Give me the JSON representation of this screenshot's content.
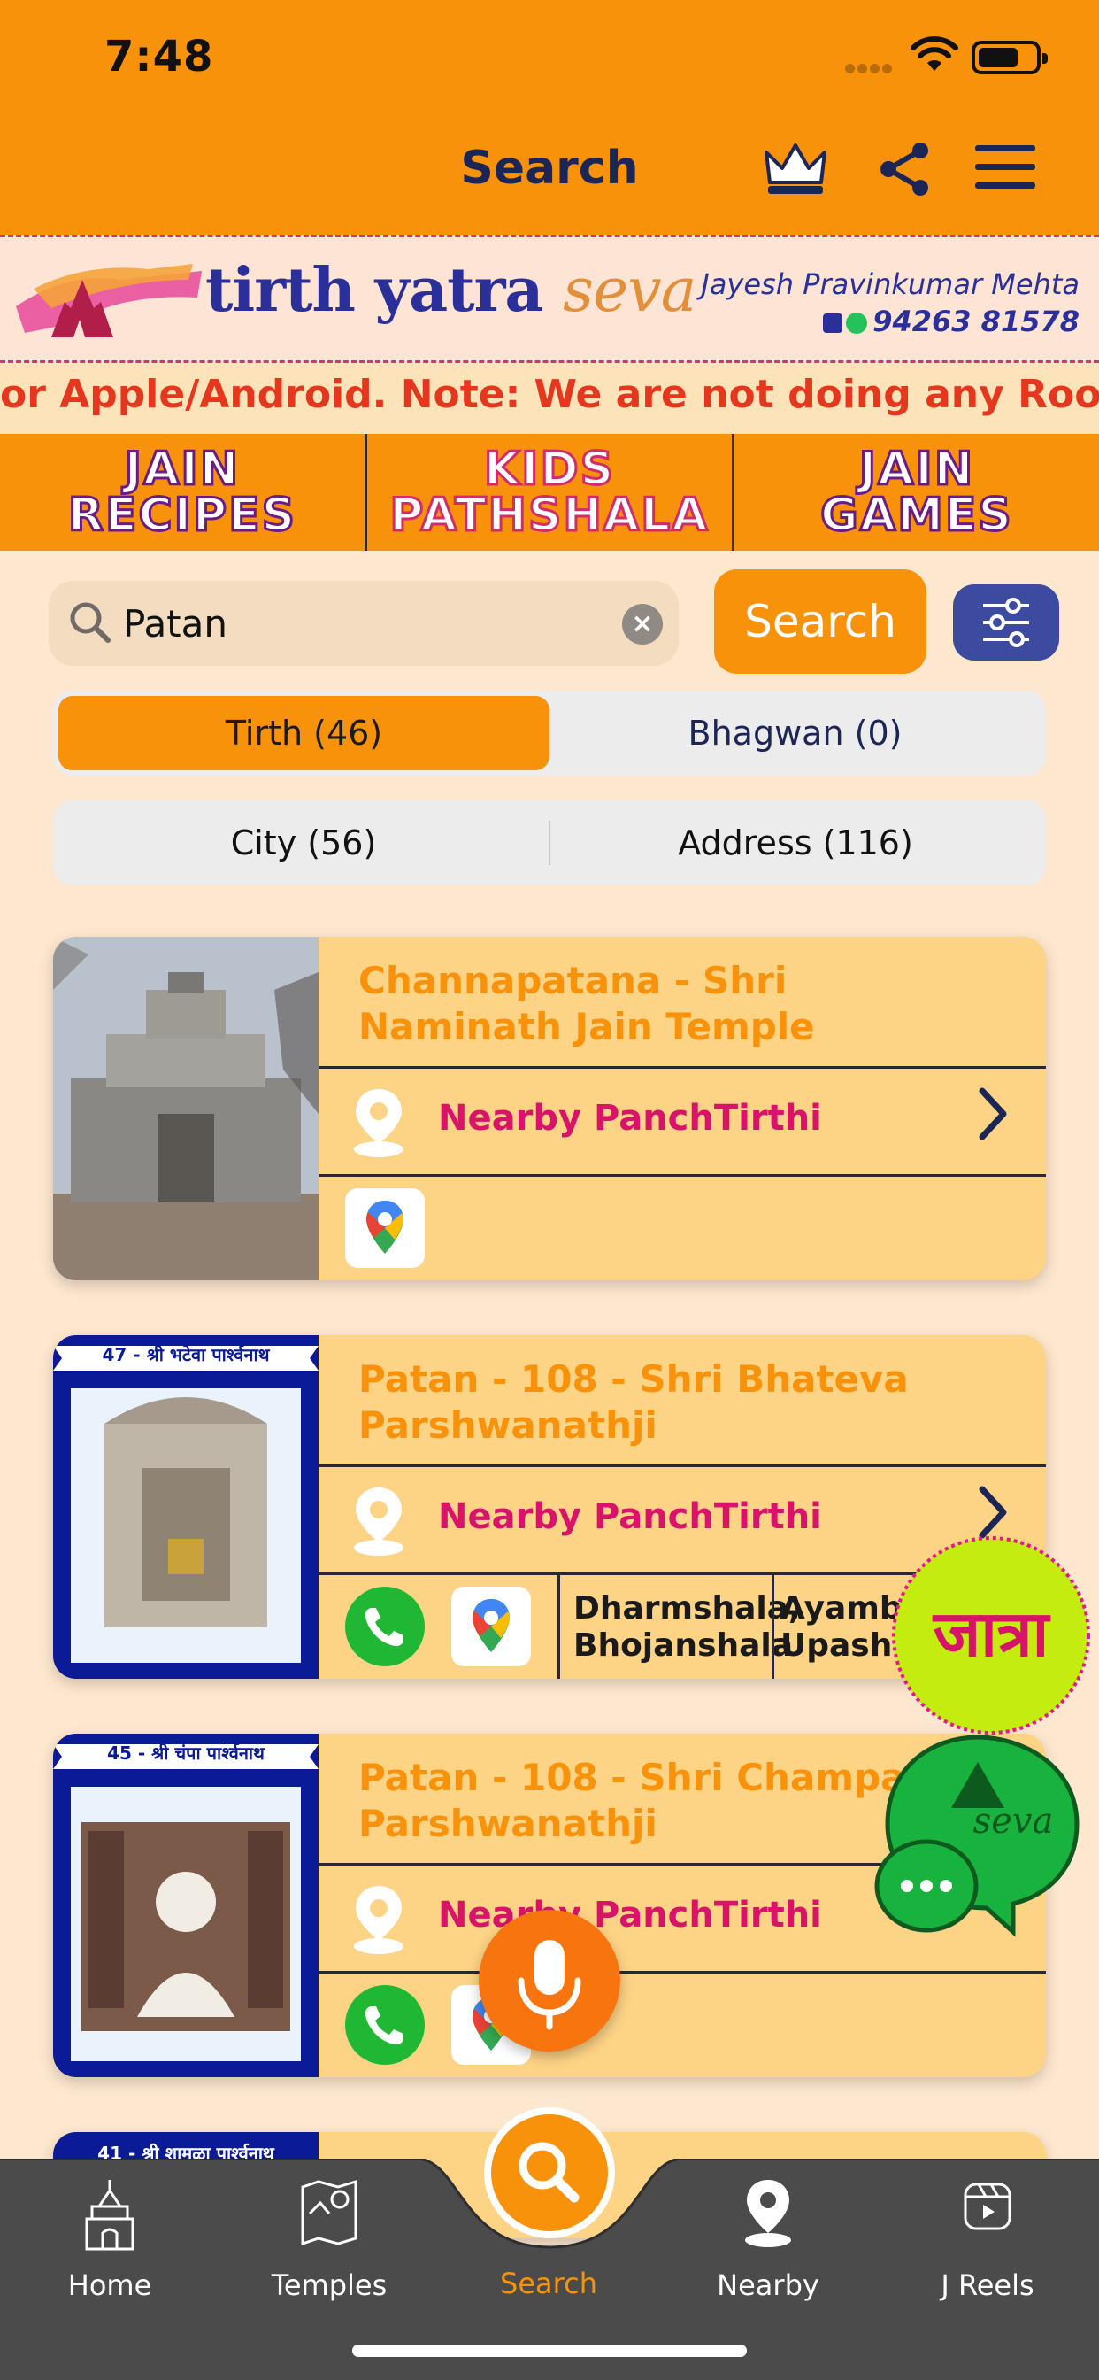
{
  "status": {
    "time": "7:48"
  },
  "header": {
    "title": "Search"
  },
  "banner": {
    "brand_main": "tirth yatra",
    "brand_seva": "seva",
    "contact_name": "Jayesh Pravinkumar Mehta",
    "contact_phone": "94263 81578"
  },
  "marquee": {
    "text": "or Apple/Android.  Note: We are not doing any Room b"
  },
  "features": [
    {
      "label": "JAIN\nRECIPES"
    },
    {
      "label": "KIDS\nPATHSHALA"
    },
    {
      "label": "JAIN\nGAMES"
    }
  ],
  "search": {
    "value": "Patan",
    "placeholder": "Search",
    "button_label": "Search"
  },
  "segments_primary": [
    {
      "label": "Tirth (46)",
      "active": true
    },
    {
      "label": "Bhagwan (0)",
      "active": false
    }
  ],
  "segments_secondary": [
    {
      "label": "City (56)"
    },
    {
      "label": "Address (116)"
    }
  ],
  "results": [
    {
      "title": "Channapatana  - Shri Naminath Jain Temple",
      "nearby_label": "Nearby PanchTirthi",
      "facilities": []
    },
    {
      "title": "Patan - 108 - Shri Bhateva Parshwanathji",
      "nearby_label": "Nearby PanchTirthi",
      "image_caption": "47 - श्री भटेवा पार्श्वनाथ",
      "facilities": [
        "Dharmshala, Bhojanshala",
        "Ayambil Upashray"
      ]
    },
    {
      "title": "Patan - 108 - Shri Champa Parshwanathji",
      "nearby_label": "Nearby PanchTirthi",
      "image_caption": "45 - श्री चंपा पार्श्वनाथ",
      "facilities": []
    },
    {
      "image_caption": "41 - श्री शामळा पार्श्वनाथ"
    }
  ],
  "floating": {
    "yatra_label": "जात्रा",
    "chat_label": "seva"
  },
  "bottom_nav": [
    {
      "label": "Home",
      "icon": "temple-icon"
    },
    {
      "label": "Temples",
      "icon": "map-icon"
    },
    {
      "label": "Search",
      "icon": "search-icon",
      "active": true
    },
    {
      "label": "Nearby",
      "icon": "location-pin-icon"
    },
    {
      "label": "J Reels",
      "icon": "reels-icon"
    }
  ],
  "colors": {
    "primary_orange": "#f8920b",
    "background": "#fde7cf",
    "card_bg": "#fdd385",
    "nav_bg": "#4b4b4b",
    "accent_pink": "#d8146a",
    "navy": "#1b2657"
  }
}
